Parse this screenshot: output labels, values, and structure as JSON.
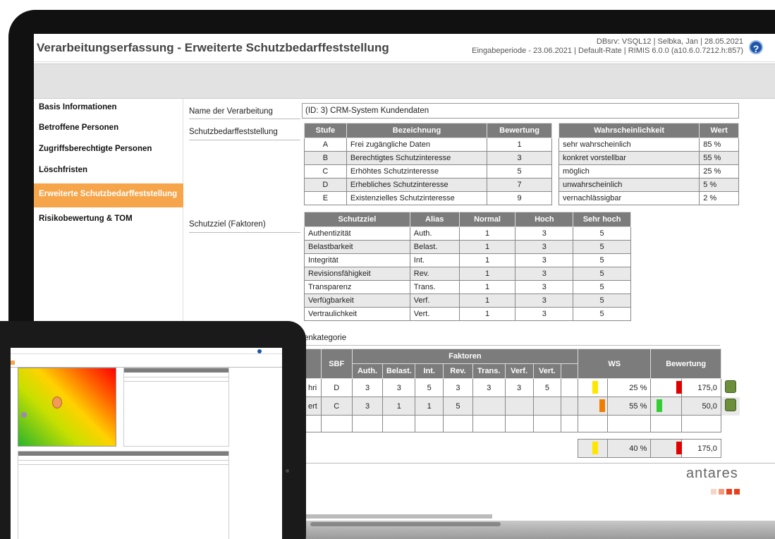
{
  "app": {
    "title": "Verarbeitungserfassung - Erweiterte Schutzbedarffeststellung",
    "meta_line1": "DBsrv: VSQL12 | Selbka, Jan | 28.05.2021",
    "meta_line2": "Eingabeperiode - 23.06.2021 | Default-Rate | RIMIS 6.0.0 (a10.6.0.7212.h:857)",
    "help_glyph": "?"
  },
  "sidebar": {
    "items": [
      {
        "label": "Basis Informationen"
      },
      {
        "label": "Betroffene Personen"
      },
      {
        "label": "Zugriffsberechtigte Personen"
      },
      {
        "label": "Löschfristen"
      },
      {
        "label": "Erweiterte Schutzbedarffeststellung"
      },
      {
        "label": "Risikobewertung & TOM"
      }
    ]
  },
  "form": {
    "name_label": "Name der Verarbeitung",
    "name_value": "(ID: 3) CRM-System Kundendaten",
    "schutzbedarf_label": "Schutzbedarffeststellung",
    "schutzziel_label": "Schutzziel (Faktoren)",
    "partial_section": "enkategorie"
  },
  "stufen_table": {
    "headers": [
      "Stufe",
      "Bezeichnung",
      "Bewertung"
    ],
    "rows": [
      [
        "A",
        "Frei zugängliche Daten",
        "1"
      ],
      [
        "B",
        "Berechtigtes Schutzinteresse",
        "3"
      ],
      [
        "C",
        "Erhöhtes Schutzinteresse",
        "5"
      ],
      [
        "D",
        "Erhebliches Schutzinteresse",
        "7"
      ],
      [
        "E",
        "Existenzielles Schutzinteresse",
        "9"
      ]
    ]
  },
  "wahrscheinlichkeit_table": {
    "headers": [
      "Wahrscheinlichkeit",
      "Wert"
    ],
    "rows": [
      [
        "sehr wahrscheinlich",
        "85 %"
      ],
      [
        "konkret vorstellbar",
        "55 %"
      ],
      [
        "möglich",
        "25 %"
      ],
      [
        "unwahrscheinlich",
        "5 %"
      ],
      [
        "vernachlässigbar",
        "2 %"
      ]
    ]
  },
  "schutzziel_table": {
    "headers": [
      "Schutzziel",
      "Alias",
      "Normal",
      "Hoch",
      "Sehr hoch"
    ],
    "rows": [
      [
        "Authentizität",
        "Auth.",
        "1",
        "3",
        "5"
      ],
      [
        "Belastbarkeit",
        "Belast.",
        "1",
        "3",
        "5"
      ],
      [
        "Integrität",
        "Int.",
        "1",
        "3",
        "5"
      ],
      [
        "Revisionsfähigkeit",
        "Rev.",
        "1",
        "3",
        "5"
      ],
      [
        "Transparenz",
        "Trans.",
        "1",
        "3",
        "5"
      ],
      [
        "Verfügbarkeit",
        "Verf.",
        "1",
        "3",
        "5"
      ],
      [
        "Vertraulichkeit",
        "Vert.",
        "1",
        "3",
        "5"
      ]
    ]
  },
  "kategorie_table": {
    "sbf": "SBF",
    "faktoren": "Faktoren",
    "ws": "WS",
    "bewertung": "Bewertung",
    "sub_headers": [
      "Auth.",
      "Belast.",
      "Int.",
      "Rev.",
      "Trans.",
      "Verf.",
      "Vert."
    ],
    "rows": [
      {
        "prefix": "hri",
        "sbf": "D",
        "f": [
          "3",
          "3",
          "5",
          "3",
          "3",
          "3",
          "5"
        ],
        "ws": "25 %",
        "ws_color": "#ffe600",
        "bew": "175,0",
        "bew_color": "#e00000"
      },
      {
        "prefix": "ert",
        "sbf": "C",
        "f": [
          "3",
          "1",
          "1",
          "5",
          "",
          "",
          ""
        ],
        "ws": "55 %",
        "ws_color": "#f07d00",
        "bew": "50,0",
        "bew_color": "#33cc33"
      }
    ],
    "total_ws": "40 %",
    "total_ws_color": "#ffe600",
    "total_bew": "175,0",
    "total_bew_color": "#e00000"
  },
  "brand": {
    "name": "antares",
    "dot_colors": [
      "#f8d4c4",
      "#f29a7a",
      "#e8401a",
      "#e8401a"
    ]
  }
}
